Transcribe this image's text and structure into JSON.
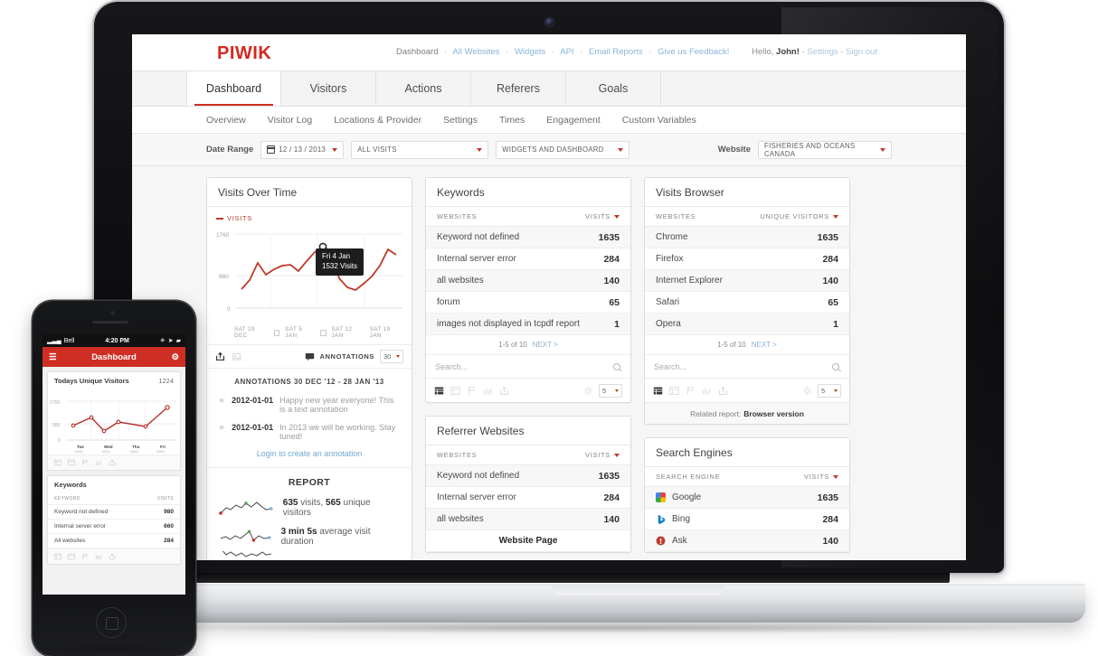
{
  "brand": {
    "logo": "PIWIK",
    "accent": "#d4291f"
  },
  "topnav": {
    "items": [
      {
        "label": "Dashboard",
        "link": false
      },
      {
        "label": "All Websites",
        "link": true
      },
      {
        "label": "Widgets",
        "link": true
      },
      {
        "label": "API",
        "link": true
      },
      {
        "label": "Email Reports",
        "link": true
      },
      {
        "label": "Give us Feedback!",
        "link": true
      }
    ],
    "greeting_prefix": "Hello,",
    "greeting_name": "John!",
    "settings": "Settings",
    "signout": "Sign out"
  },
  "tabs": [
    {
      "label": "Dashboard",
      "active": true
    },
    {
      "label": "Visitors",
      "active": false
    },
    {
      "label": "Actions",
      "active": false
    },
    {
      "label": "Referers",
      "active": false
    },
    {
      "label": "Goals",
      "active": false
    }
  ],
  "subtabs": [
    "Overview",
    "Visitor Log",
    "Locations & Provider",
    "Settings",
    "Times",
    "Engagement",
    "Custom Variables"
  ],
  "controls": {
    "date_range_label": "Date Range",
    "date_value": "12 / 13 / 2013",
    "segment_value": "ALL VISITS",
    "dashboard_value": "WIDGETS AND DASHBOARD",
    "website_label": "Website",
    "website_value": "FISHERIES AND OCEANS CANADA"
  },
  "visits_over_time": {
    "title": "Visits Over Time",
    "legend": "VISITS",
    "tooltip_date": "Fri 4 Jan",
    "tooltip_value": "1532 Visits",
    "period_select": "30",
    "annotations_button": "ANNOTATIONS",
    "annotations_header": "ANNOTATIONS 30 DEC '12 - 28 JAN '13",
    "annotations": [
      {
        "date": "2012-01-01",
        "text": "Happy new year everyone! This is a text annotation"
      },
      {
        "date": "2012-01-01",
        "text": "In 2013 we will be working. Stay tuned!"
      }
    ],
    "annotation_link": "Login to create an annotation",
    "report_title": "REPORT",
    "report_rows": [
      {
        "value": "635",
        "label": "visits,",
        "value2": "565",
        "label2": "unique visitors"
      },
      {
        "value": "3 min 5s",
        "label": "average visit duration",
        "value2": "",
        "label2": ""
      }
    ]
  },
  "chart_data": {
    "type": "line",
    "title": "Visits Over Time",
    "series": [
      {
        "name": "VISITS",
        "values": [
          440,
          690,
          1130,
          820,
          960,
          1060,
          1080,
          930,
          1180,
          1400,
          1532,
          1440,
          880,
          660,
          600,
          720,
          860,
          1060,
          1420,
          1300,
          1000,
          880,
          880
        ]
      }
    ],
    "x": [
      "SAT 29 DEC",
      "SAT 5 JAN",
      "SAT 12 JAN",
      "SAT 19 JAN"
    ],
    "xlabel": "",
    "ylabel": "",
    "yticks": [
      "1760",
      "880",
      "0"
    ],
    "ylim": [
      0,
      1760
    ],
    "grid": true,
    "legend_position": "top-left",
    "annotation": {
      "date": "Fri 4 Jan",
      "value": "1532 Visits"
    }
  },
  "keywords": {
    "title": "Keywords",
    "col_label": "WEBSITES",
    "col_value": "VISITS",
    "rows": [
      {
        "label": "Keyword not defined",
        "value": "1635"
      },
      {
        "label": "Internal server error",
        "value": "284"
      },
      {
        "label": "all websites",
        "value": "140"
      },
      {
        "label": "forum",
        "value": "65"
      },
      {
        "label": "images not displayed in tcpdf report",
        "value": "1"
      }
    ],
    "pager": "1-5 of 10",
    "next": "NEXT >",
    "search_placeholder": "Search...",
    "rows_select": "5"
  },
  "referrer_websites": {
    "title": "Referrer Websites",
    "col_label": "WEBSITES",
    "col_value": "VISITS",
    "rows": [
      {
        "label": "Keyword not defined",
        "value": "1635"
      },
      {
        "label": "Internal server error",
        "value": "284"
      },
      {
        "label": "all websites",
        "value": "140"
      },
      {
        "label": "Website Page",
        "value": ""
      }
    ]
  },
  "visits_browser": {
    "title": "Visits Browser",
    "col_label": "WEBSITES",
    "col_value": "UNIQUE VISITORS",
    "rows": [
      {
        "label": "Chrome",
        "value": "1635"
      },
      {
        "label": "Firefox",
        "value": "284"
      },
      {
        "label": "Internet Explorer",
        "value": "140"
      },
      {
        "label": "Safari",
        "value": "65"
      },
      {
        "label": "Opera",
        "value": "1"
      }
    ],
    "pager": "1-5 of 10",
    "next": "NEXT >",
    "search_placeholder": "Search...",
    "rows_select": "5",
    "related_prefix": "Related report:",
    "related_value": "Browser version"
  },
  "search_engines": {
    "title": "Search Engines",
    "col_label": "SEARCH ENGINE",
    "col_value": "VISITS",
    "rows": [
      {
        "label": "Google",
        "value": "1635",
        "color": "#4285f4"
      },
      {
        "label": "Bing",
        "value": "284",
        "color": "#0b7fc7"
      },
      {
        "label": "Ask",
        "value": "140",
        "color": "#c0392b"
      }
    ]
  },
  "phone": {
    "carrier": "Bell",
    "time": "4:20 PM",
    "nav_title": "Dashboard",
    "card1_title": "Todays Unique Visitors",
    "card1_value": "1224",
    "chart_yticks": [
      "1760",
      "880",
      "0"
    ],
    "chart_xticks": [
      {
        "day": "Tue",
        "date": "01/01"
      },
      {
        "day": "Wed",
        "date": "02/01"
      },
      {
        "day": "Thu",
        "date": "03/01"
      },
      {
        "day": "Fri",
        "date": "04/01"
      }
    ],
    "chart_values": [
      560,
      900,
      400,
      760,
      620,
      1300
    ],
    "card2_title": "Keywords",
    "card2_col_label": "KEYWORD",
    "card2_col_value": "VISITS",
    "card2_rows": [
      {
        "label": "Keyword not defined",
        "value": "980"
      },
      {
        "label": "Internal server error",
        "value": "660"
      },
      {
        "label": "All websites",
        "value": "284"
      }
    ]
  }
}
